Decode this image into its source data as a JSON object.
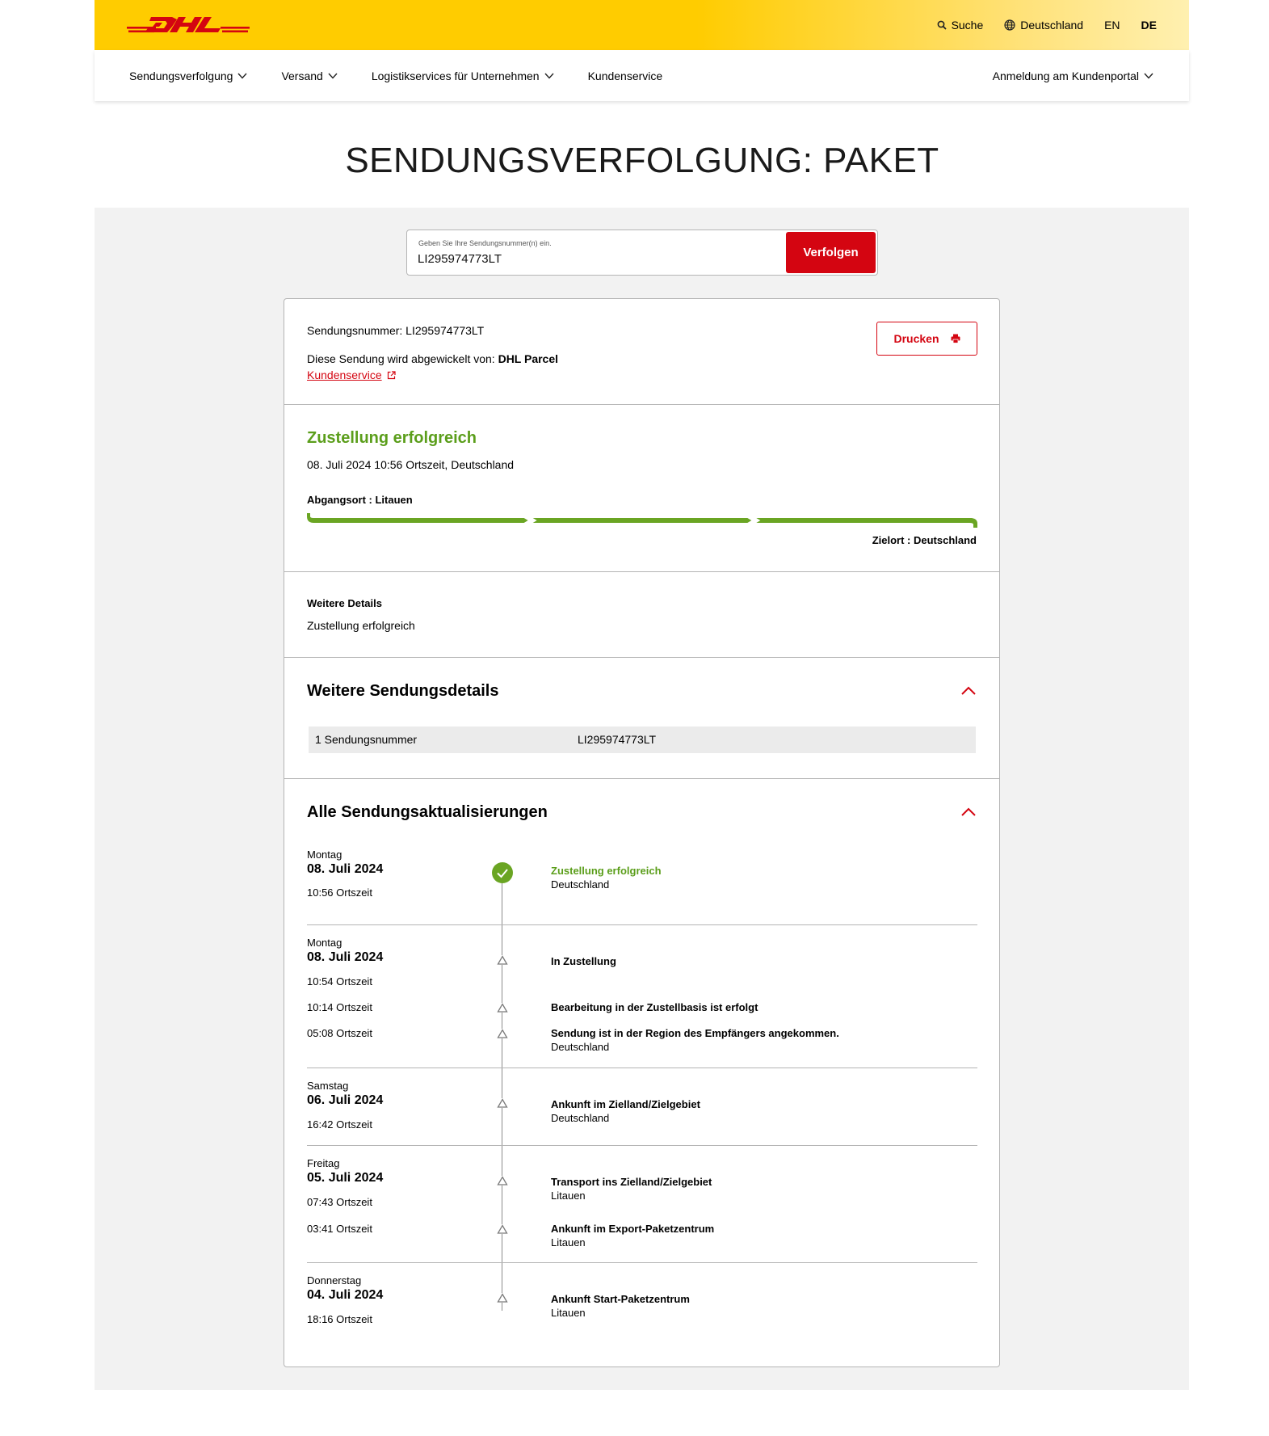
{
  "header": {
    "logo_text": "DHL",
    "search_label": "Suche",
    "country_label": "Deutschland",
    "lang_en": "EN",
    "lang_de": "DE",
    "brand_yellow": "#ffcc00",
    "brand_red": "#d40511"
  },
  "nav": {
    "items": [
      {
        "label": "Sendungsverfolgung"
      },
      {
        "label": "Versand"
      },
      {
        "label": "Logistikservices für Unternehmen"
      },
      {
        "label": "Kundenservice"
      }
    ],
    "login_label": "Anmeldung am Kundenportal"
  },
  "page": {
    "title": "SENDUNGSVERFOLGUNG: PAKET"
  },
  "search": {
    "label": "Geben Sie Ihre Sendungsnummer(n) ein.",
    "value": "LI295974773LT",
    "button_label": "Verfolgen"
  },
  "shipment": {
    "number_text": "Sendungsnummer: LI295974773LT",
    "handled_prefix": "Diese Sendung wird abgewickelt von: ",
    "handled_by": "DHL Parcel",
    "customer_service_link": "Kundenservice",
    "print_label": "Drucken"
  },
  "status": {
    "title": "Zustellung erfolgreich",
    "datetime": "08. Juli 2024 10:56 Ortszeit, Deutschland",
    "origin": "Abgangsort : Litauen",
    "destination": "Zielort : Deutschland",
    "progress_fraction": 1.0,
    "progress_color": "#6aa523"
  },
  "more_details": {
    "title": "Weitere Details",
    "text": "Zustellung erfolgreich"
  },
  "shipment_details": {
    "title": "Weitere Sendungsdetails",
    "rows": [
      {
        "key": "1 Sendungsnummer",
        "value": "LI295974773LT"
      }
    ]
  },
  "updates": {
    "title": "Alle Sendungsaktualisierungen",
    "groups": [
      {
        "day": "Montag",
        "date": "08. Juli 2024",
        "events": [
          {
            "time": "10:56 Ortszeit",
            "title": "Zustellung erfolgreich",
            "location": "Deutschland",
            "delivered": true
          }
        ]
      },
      {
        "day": "Montag",
        "date": "08. Juli 2024",
        "events": [
          {
            "time": "10:54 Ortszeit",
            "title": "In Zustellung",
            "location": ""
          },
          {
            "time": "10:14 Ortszeit",
            "title": "Bearbeitung in der Zustellbasis ist erfolgt",
            "location": ""
          },
          {
            "time": "05:08 Ortszeit",
            "title": "Sendung ist in der Region des Empfängers angekommen.",
            "location": "Deutschland"
          }
        ]
      },
      {
        "day": "Samstag",
        "date": "06. Juli 2024",
        "events": [
          {
            "time": "16:42 Ortszeit",
            "title": "Ankunft im Zielland/Zielgebiet",
            "location": "Deutschland"
          }
        ]
      },
      {
        "day": "Freitag",
        "date": "05. Juli 2024",
        "events": [
          {
            "time": "07:43 Ortszeit",
            "title": "Transport ins Zielland/Zielgebiet",
            "location": "Litauen"
          },
          {
            "time": "03:41 Ortszeit",
            "title": "Ankunft im Export-Paketzentrum",
            "location": "Litauen"
          }
        ]
      },
      {
        "day": "Donnerstag",
        "date": "04. Juli 2024",
        "events": [
          {
            "time": "18:16 Ortszeit",
            "title": "Ankunft Start-Paketzentrum",
            "location": "Litauen"
          }
        ]
      }
    ]
  }
}
